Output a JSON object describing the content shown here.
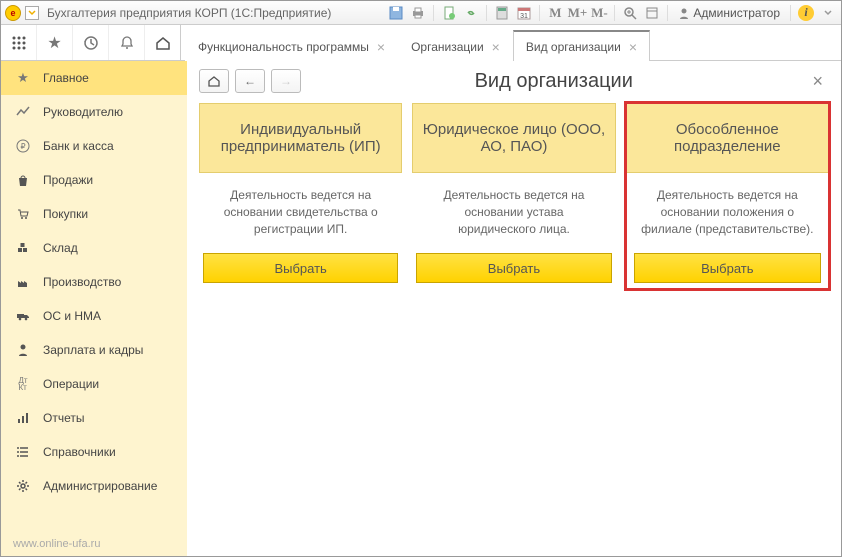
{
  "titlebar": {
    "app_title": "Бухгалтерия предприятия КОРП  (1С:Предприятие)",
    "m_labels": [
      "M",
      "M+",
      "M-"
    ],
    "user": "Администратор"
  },
  "tabs": [
    {
      "label": "Функциональность программы",
      "active": false
    },
    {
      "label": "Организации",
      "active": false
    },
    {
      "label": "Вид организации",
      "active": true
    }
  ],
  "sidebar": {
    "items": [
      {
        "label": "Главное",
        "icon": "star"
      },
      {
        "label": "Руководителю",
        "icon": "chart"
      },
      {
        "label": "Банк и касса",
        "icon": "ruble"
      },
      {
        "label": "Продажи",
        "icon": "bag"
      },
      {
        "label": "Покупки",
        "icon": "cart"
      },
      {
        "label": "Склад",
        "icon": "boxes"
      },
      {
        "label": "Производство",
        "icon": "factory"
      },
      {
        "label": "ОС и НМА",
        "icon": "truck"
      },
      {
        "label": "Зарплата и кадры",
        "icon": "person"
      },
      {
        "label": "Операции",
        "icon": "dtk"
      },
      {
        "label": "Отчеты",
        "icon": "bars"
      },
      {
        "label": "Справочники",
        "icon": "list"
      },
      {
        "label": "Администрирование",
        "icon": "gear"
      }
    ]
  },
  "watermark": "www.online-ufa.ru",
  "main": {
    "title": "Вид организации",
    "cards": [
      {
        "title": "Индивидуальный предприниматель (ИП)",
        "desc": "Деятельность ведется на основании свидетельства о регистрации ИП.",
        "button": "Выбрать"
      },
      {
        "title": "Юридическое лицо (ООО, АО, ПАО)",
        "desc": "Деятельность ведется на основании устава юридического лица.",
        "button": "Выбрать"
      },
      {
        "title": "Обособленное подразделение",
        "desc": "Деятельность ведется на основании положения о филиале (представительстве).",
        "button": "Выбрать"
      }
    ]
  }
}
